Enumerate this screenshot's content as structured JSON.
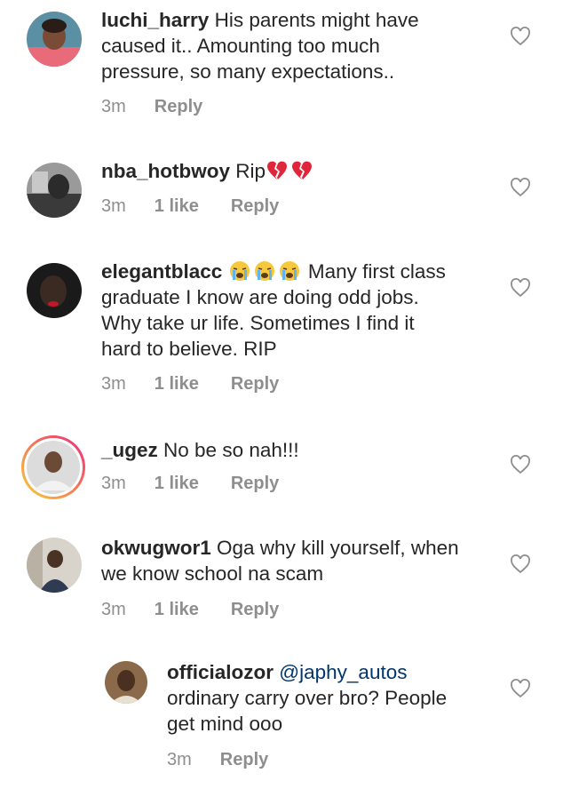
{
  "comments": [
    {
      "username": "luchi_harry",
      "lines": [
        "His parents might have",
        "caused it.. Amounting too much",
        "pressure, so many expectations.."
      ],
      "time": "3m",
      "likes": "",
      "reply_label": "Reply",
      "icon": "heart-outline-icon"
    },
    {
      "username": "nba_hotbwoy",
      "lines": [
        "Rip"
      ],
      "emoji": "broken-heart-icon",
      "time": "3m",
      "likes": "1 like",
      "reply_label": "Reply",
      "icon": "heart-outline-icon"
    },
    {
      "username": "elegantblacc",
      "lines": [
        "Many first class",
        "graduate I know are doing odd jobs.",
        "Why take ur life. Sometimes I find it",
        "hard to believe. RIP"
      ],
      "emoji": "crying-face-icon",
      "time": "3m",
      "likes": "1 like",
      "reply_label": "Reply",
      "icon": "heart-outline-icon"
    },
    {
      "username": "_ugez",
      "lines": [
        "No be so nah!!!"
      ],
      "time": "3m",
      "likes": "1 like",
      "reply_label": "Reply",
      "icon": "heart-outline-icon"
    },
    {
      "username": "okwugwor1",
      "lines": [
        "Oga why kill yourself, when",
        "we know school na scam"
      ],
      "time": "3m",
      "likes": "1 like",
      "reply_label": "Reply",
      "icon": "heart-outline-icon"
    },
    {
      "username": "officialozor",
      "mention": "@japhy_autos",
      "lines": [
        "ordinary carry over bro? People",
        "get mind ooo"
      ],
      "time": "3m",
      "likes": "",
      "reply_label": "Reply",
      "icon": "heart-outline-icon"
    }
  ],
  "colors": {
    "text": "#262626",
    "meta": "#8e8e8e",
    "mention": "#00376b",
    "story_ring_start": "#f9ce34",
    "story_ring_end": "#ee2a7b"
  }
}
